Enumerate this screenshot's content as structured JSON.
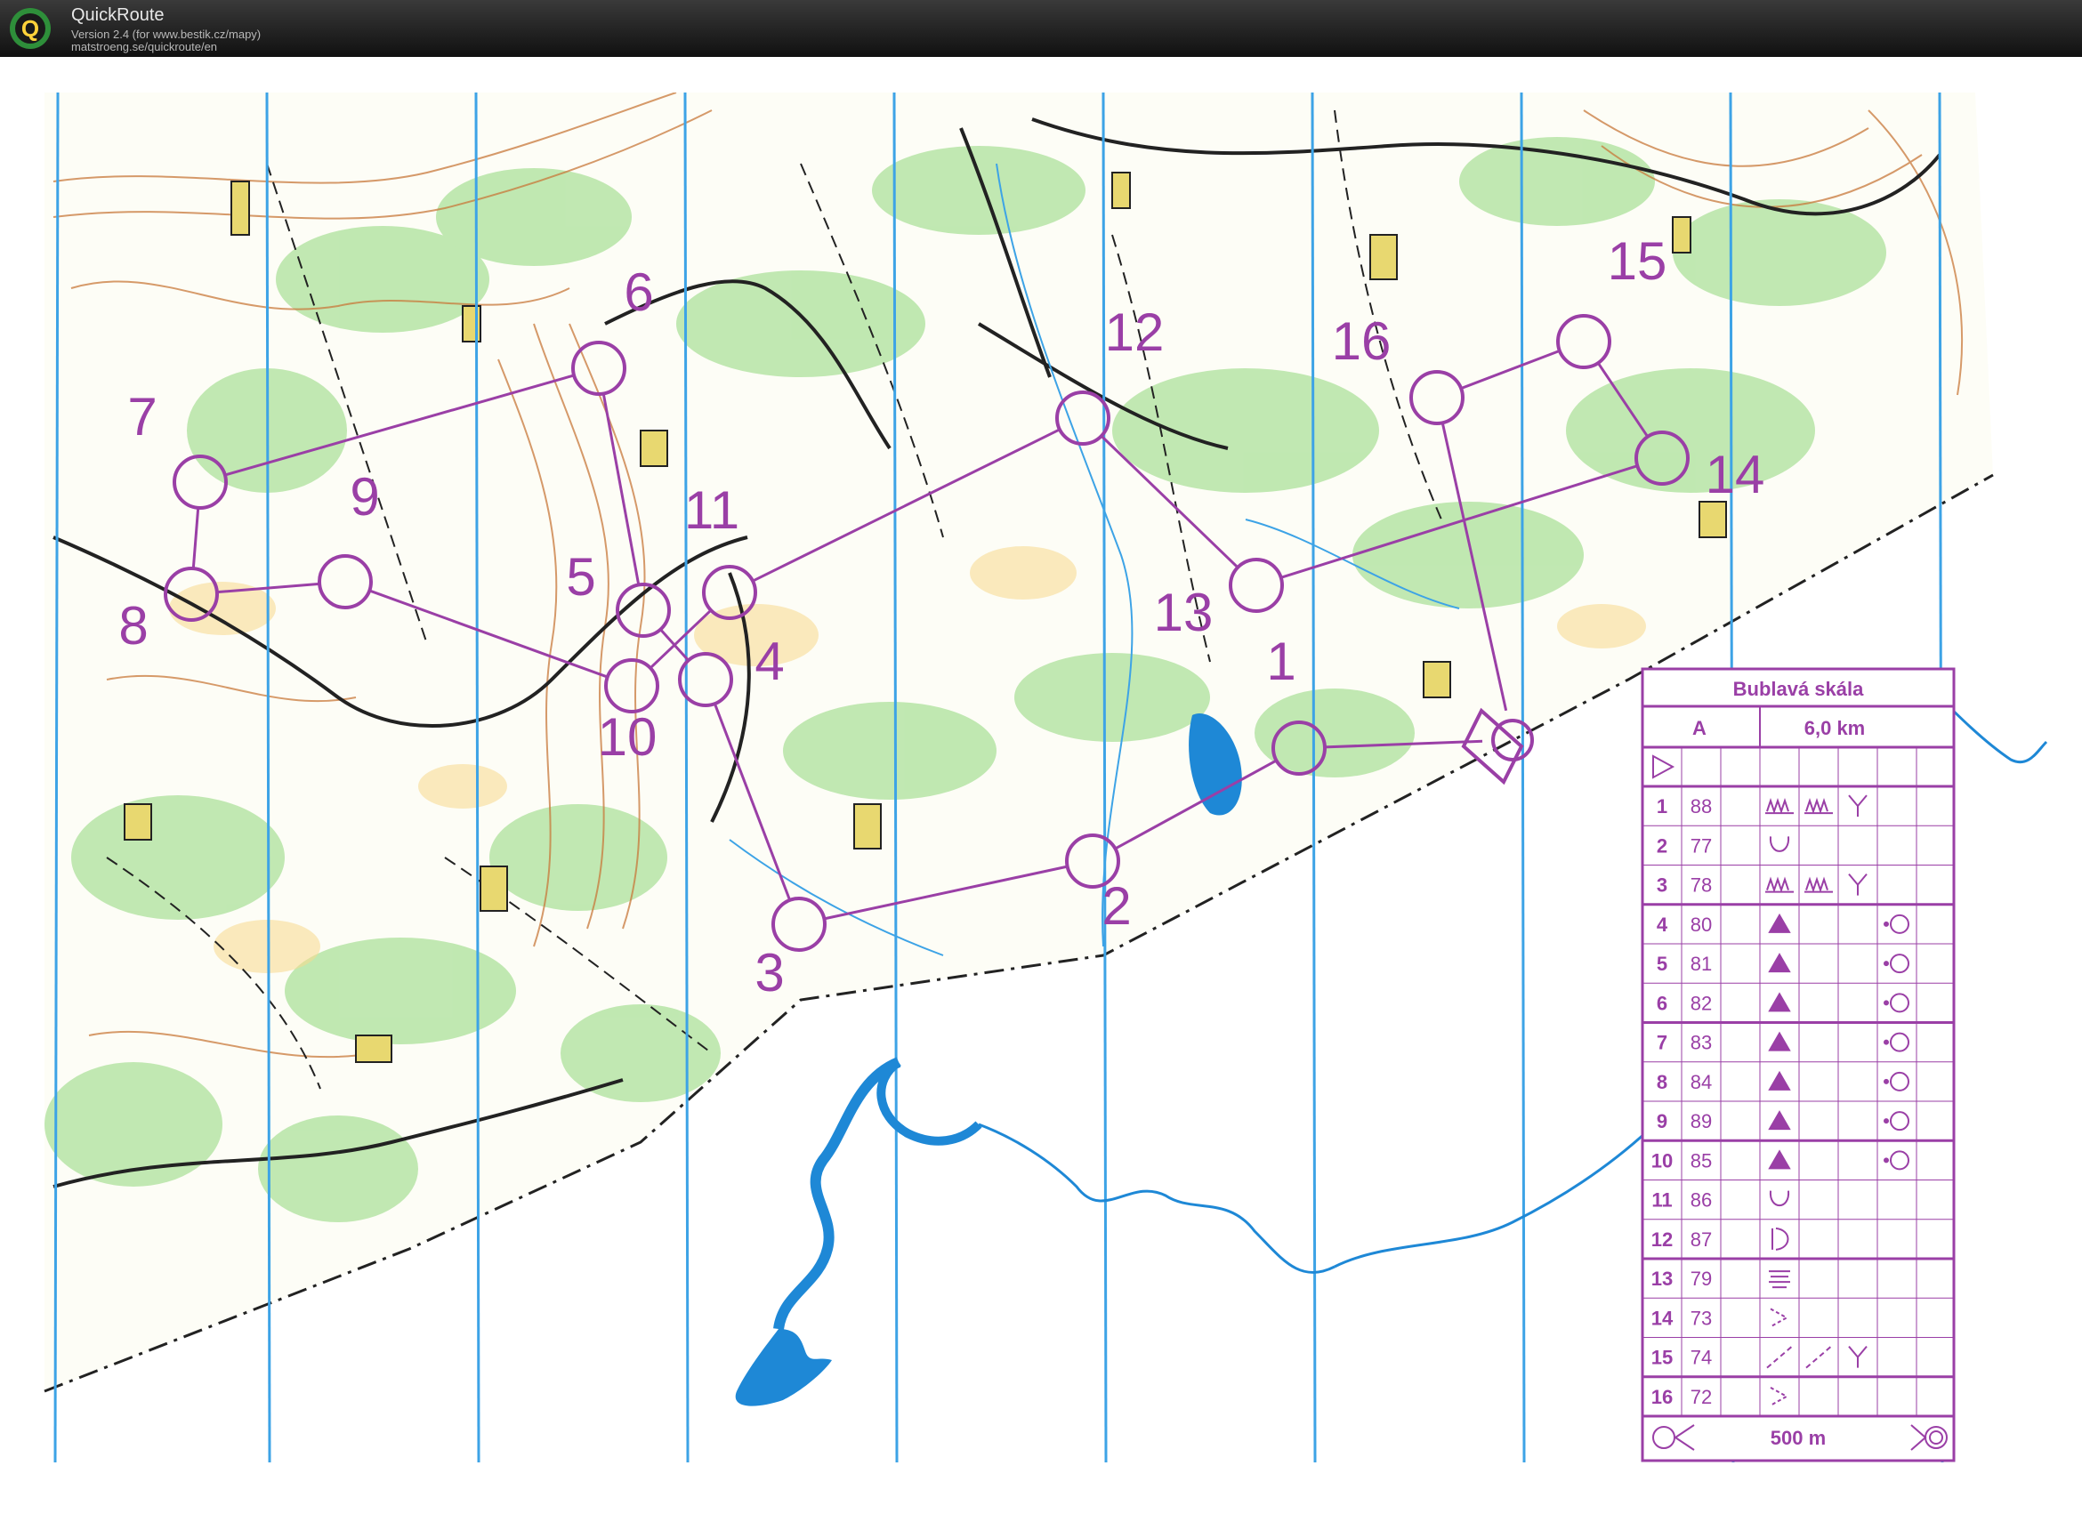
{
  "window": {
    "app_name": "QuickRoute",
    "version_line": "Version 2.4  (for www.bestik.cz/mapy)",
    "url_line": "matstroeng.se/quickroute/en",
    "logo_letter": "Q"
  },
  "colors": {
    "course": "#9a3fa6",
    "water": "#1e88d6",
    "magnetic_north_lines": "#3da3e6",
    "vegetation": "#7fcf6a",
    "contours": "#c8783a",
    "paths": "#222222"
  },
  "course": {
    "start_control": "start-triangle",
    "controls": [
      {
        "label": "1"
      },
      {
        "label": "2"
      },
      {
        "label": "3"
      },
      {
        "label": "4"
      },
      {
        "label": "5"
      },
      {
        "label": "6"
      },
      {
        "label": "7"
      },
      {
        "label": "8"
      },
      {
        "label": "9"
      },
      {
        "label": "10"
      },
      {
        "label": "11"
      },
      {
        "label": "12"
      },
      {
        "label": "13"
      },
      {
        "label": "14"
      },
      {
        "label": "15"
      },
      {
        "label": "16"
      }
    ]
  },
  "descriptions": {
    "event_name": "Bublavá skála",
    "course_name": "A",
    "course_length": "6,0 km",
    "finish_distance": "500 m",
    "rows": [
      {
        "num": "1",
        "code": "88",
        "feature": "rock-pillars-icon",
        "feature2": "rock-pillars-icon",
        "extra": "junction-y-icon"
      },
      {
        "num": "2",
        "code": "77",
        "feature": "depression-icon",
        "feature2": "",
        "extra": ""
      },
      {
        "num": "3",
        "code": "78",
        "feature": "rock-pillars-icon",
        "feature2": "rock-pillars-icon",
        "extra": "junction-y-icon"
      },
      {
        "num": "4",
        "code": "80",
        "feature": "boulder-triangle-icon",
        "feature2": "",
        "extra": "position-circle-icon"
      },
      {
        "num": "5",
        "code": "81",
        "feature": "boulder-triangle-icon",
        "feature2": "",
        "extra": "position-circle-icon"
      },
      {
        "num": "6",
        "code": "82",
        "feature": "boulder-triangle-icon",
        "feature2": "",
        "extra": "position-circle-icon"
      },
      {
        "num": "7",
        "code": "83",
        "feature": "boulder-triangle-icon",
        "feature2": "",
        "extra": "position-circle-icon"
      },
      {
        "num": "8",
        "code": "84",
        "feature": "boulder-triangle-icon",
        "feature2": "",
        "extra": "position-circle-icon"
      },
      {
        "num": "9",
        "code": "89",
        "feature": "boulder-triangle-icon",
        "feature2": "",
        "extra": "position-circle-icon"
      },
      {
        "num": "10",
        "code": "85",
        "feature": "boulder-triangle-icon",
        "feature2": "",
        "extra": "position-circle-icon"
      },
      {
        "num": "11",
        "code": "86",
        "feature": "depression-icon",
        "feature2": "",
        "extra": ""
      },
      {
        "num": "12",
        "code": "87",
        "feature": "reentrant-icon",
        "feature2": "",
        "extra": ""
      },
      {
        "num": "13",
        "code": "79",
        "feature": "marsh-icon",
        "feature2": "",
        "extra": ""
      },
      {
        "num": "14",
        "code": "73",
        "feature": "open-angle-icon",
        "feature2": "",
        "extra": ""
      },
      {
        "num": "15",
        "code": "74",
        "feature": "path-dashes-icon",
        "feature2": "path-dashes-icon",
        "extra": "junction-y-icon"
      },
      {
        "num": "16",
        "code": "72",
        "feature": "open-angle-icon",
        "feature2": "",
        "extra": ""
      }
    ]
  }
}
